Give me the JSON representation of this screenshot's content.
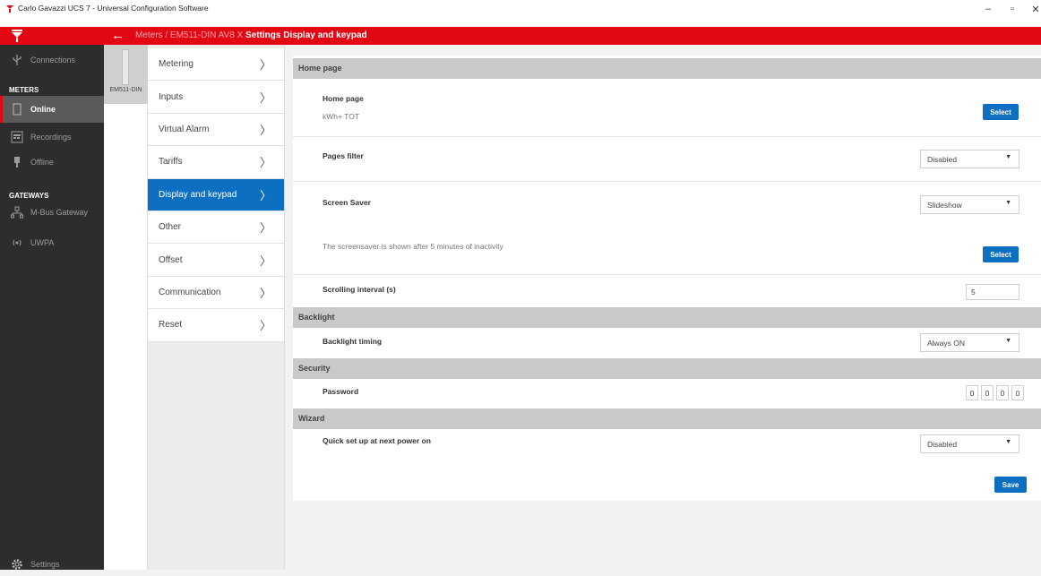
{
  "window": {
    "title": "Carlo Gavazzi UCS 7 - Universal Configuration Software",
    "minimize_glyph": "–",
    "maximize_glyph": "▫",
    "close_glyph": "✕"
  },
  "header": {
    "breadcrumb_path": "Meters / EM511-DIN AV8 X",
    "breadcrumb_settings": "Settings",
    "breadcrumb_page": "Display and keypad",
    "accent_color": "#e30613"
  },
  "sidebar": {
    "connections": "Connections",
    "meters_section": "METERS",
    "online": "Online",
    "recordings": "Recordings",
    "offline": "Offline",
    "gateways_section": "GATEWAYS",
    "mbus_gateway": "M-Bus Gateway",
    "uwpa": "UWPA",
    "settings": "Settings"
  },
  "device": {
    "label": "EM511-DIN"
  },
  "menu": {
    "items": [
      {
        "label": "Metering"
      },
      {
        "label": "Inputs"
      },
      {
        "label": "Virtual Alarm"
      },
      {
        "label": "Tariffs"
      },
      {
        "label": "Display and keypad",
        "active": true
      },
      {
        "label": "Other"
      },
      {
        "label": "Offset"
      },
      {
        "label": "Communication"
      },
      {
        "label": "Reset"
      }
    ],
    "active_color": "#0c6fc2"
  },
  "content": {
    "home_page_section": "Home page",
    "home_page_label": "Home page",
    "home_page_value": "kWh+ TOT",
    "select_button": "Select",
    "pages_filter_label": "Pages filter",
    "pages_filter_value": "Disabled",
    "screen_saver_label": "Screen Saver",
    "screen_saver_value": "Slideshow",
    "screen_saver_note": "The screensaver is shown after 5 minutes of inactivity",
    "screen_saver_select_button": "Select",
    "scrolling_interval_label": "Scrolling interval (s)",
    "scrolling_interval_value": "5",
    "backlight_section": "Backlight",
    "backlight_timing_label": "Backlight timing",
    "backlight_timing_value": "Always ON",
    "security_section": "Security",
    "password_label": "Password",
    "password_digits": [
      "0",
      "0",
      "0",
      "0"
    ],
    "wizard_section": "Wizard",
    "quick_setup_label": "Quick set up at next power on",
    "quick_setup_value": "Disabled",
    "save_button": "Save"
  }
}
